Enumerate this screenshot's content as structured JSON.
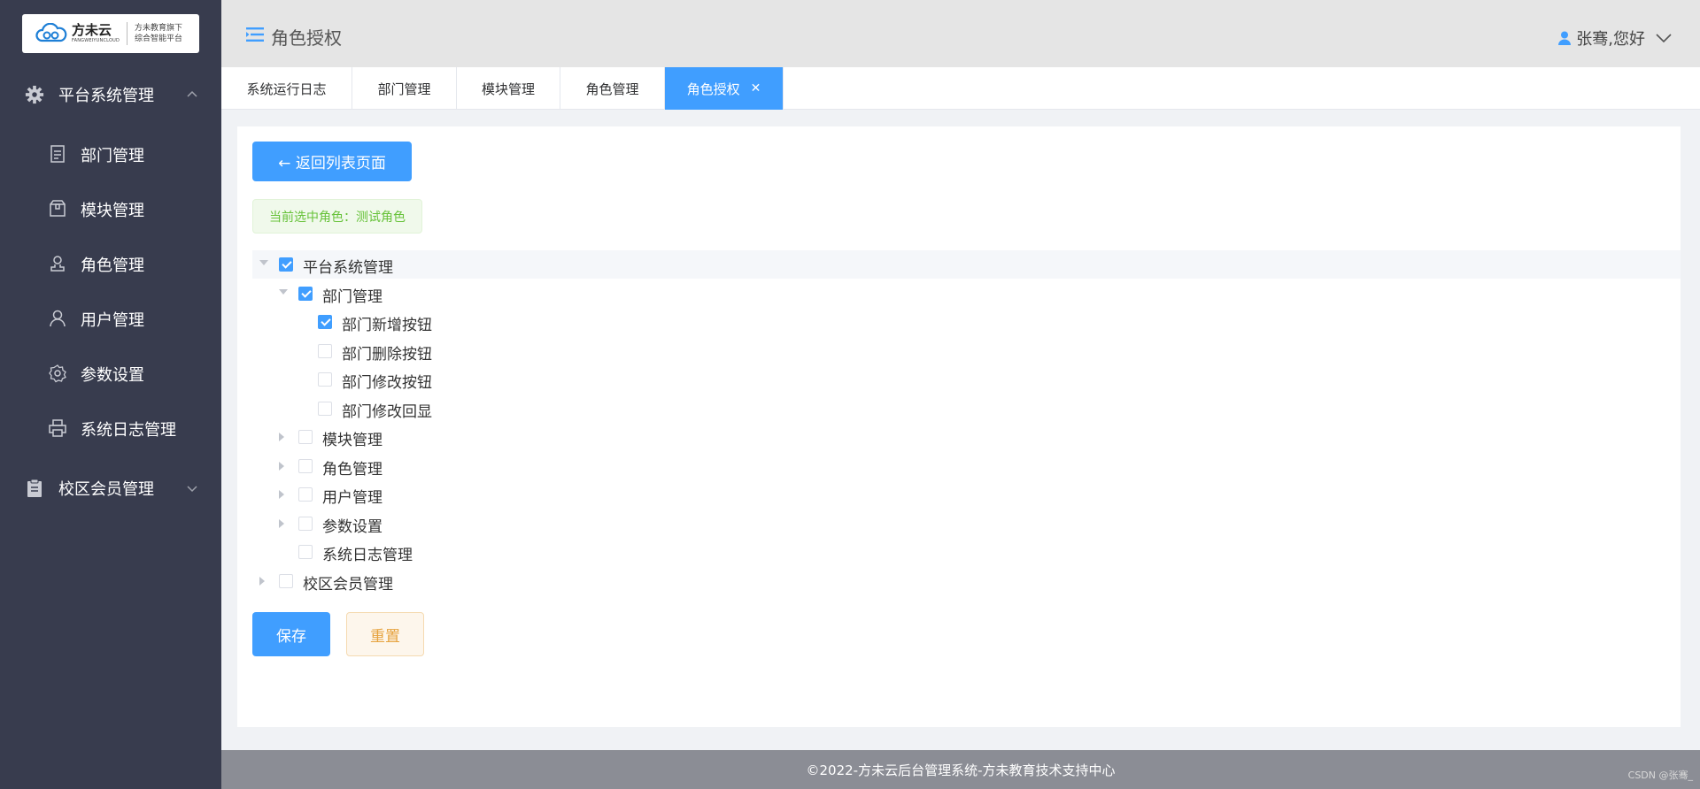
{
  "logo": {
    "name": "方未云",
    "en": "FANGWEIYUNCLOUD",
    "tagline_1": "方未教育旗下",
    "tagline_2": "综合智能平台"
  },
  "sidebar": {
    "groups": [
      {
        "label": "平台系统管理",
        "icon": "gear-icon",
        "expanded": true
      },
      {
        "label": "校区会员管理",
        "icon": "clipboard-icon",
        "expanded": false
      }
    ],
    "items": [
      {
        "label": "部门管理",
        "icon": "document-icon"
      },
      {
        "label": "模块管理",
        "icon": "box-icon"
      },
      {
        "label": "角色管理",
        "icon": "user-stamp-icon"
      },
      {
        "label": "用户管理",
        "icon": "user-icon"
      },
      {
        "label": "参数设置",
        "icon": "settings-icon"
      },
      {
        "label": "系统日志管理",
        "icon": "printer-icon"
      }
    ]
  },
  "header": {
    "title": "角色授权",
    "user_greeting": "张骞,您好"
  },
  "tabs": [
    {
      "label": "系统运行日志",
      "active": false
    },
    {
      "label": "部门管理",
      "active": false
    },
    {
      "label": "模块管理",
      "active": false
    },
    {
      "label": "角色管理",
      "active": false
    },
    {
      "label": "角色授权",
      "active": true,
      "closable": true
    }
  ],
  "main": {
    "back_label": "← 返回列表页面",
    "current_role": "当前选中角色：测试角色",
    "tree": [
      {
        "label": "平台系统管理",
        "level": 0,
        "checked": true,
        "expander": "down"
      },
      {
        "label": "部门管理",
        "level": 1,
        "checked": true,
        "expander": "down"
      },
      {
        "label": "部门新增按钮",
        "level": 2,
        "checked": true,
        "expander": "none"
      },
      {
        "label": "部门删除按钮",
        "level": 2,
        "checked": false,
        "expander": "none"
      },
      {
        "label": "部门修改按钮",
        "level": 2,
        "checked": false,
        "expander": "none"
      },
      {
        "label": "部门修改回显",
        "level": 2,
        "checked": false,
        "expander": "none"
      },
      {
        "label": "模块管理",
        "level": 1,
        "checked": false,
        "expander": "right"
      },
      {
        "label": "角色管理",
        "level": 1,
        "checked": false,
        "expander": "right"
      },
      {
        "label": "用户管理",
        "level": 1,
        "checked": false,
        "expander": "right"
      },
      {
        "label": "参数设置",
        "level": 1,
        "checked": false,
        "expander": "right"
      },
      {
        "label": "系统日志管理",
        "level": 1,
        "checked": false,
        "expander": "none"
      },
      {
        "label": "校区会员管理",
        "level": 0,
        "checked": false,
        "expander": "right"
      }
    ],
    "save_label": "保存",
    "reset_label": "重置"
  },
  "footer": {
    "text": "©2022-方未云后台管理系统-方未教育技术支持中心",
    "watermark": "CSDN @张骞_"
  },
  "colors": {
    "sidebar_bg": "#383c4e",
    "accent": "#409eff",
    "header_bg": "#e5e5e5",
    "footer_bg": "#8b8d95"
  }
}
